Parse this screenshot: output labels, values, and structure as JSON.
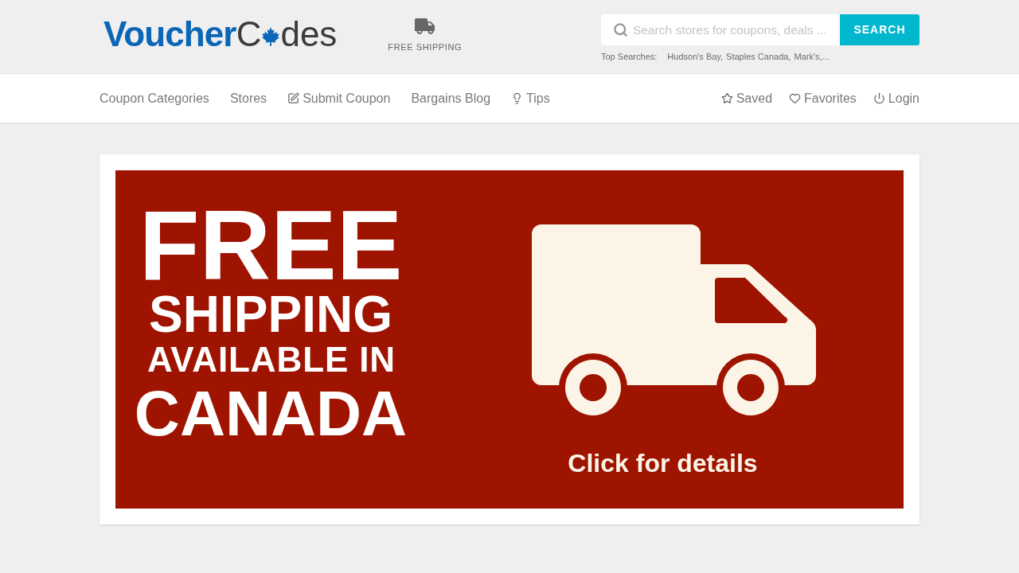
{
  "header": {
    "logo": {
      "first": "Voucher",
      "second_start": "C",
      "second_end": "des"
    },
    "free_shipping_link": "FREE SHIPPING",
    "search": {
      "placeholder": "Search stores for coupons, deals ...",
      "button": "SEARCH"
    },
    "top_searches": {
      "label": "Top Searches:",
      "items": [
        "Hudson's Bay,",
        "Staples Canada,",
        "Mark's,..."
      ]
    }
  },
  "nav": {
    "left": [
      {
        "label": "Coupon Categories",
        "kind": "categories"
      },
      {
        "label": "Stores",
        "kind": "stores"
      },
      {
        "label": "Submit Coupon",
        "kind": "submit"
      },
      {
        "label": "Bargains Blog",
        "kind": "blog"
      },
      {
        "label": "Tips",
        "kind": "tips"
      }
    ],
    "right": [
      {
        "label": "Saved",
        "kind": "saved"
      },
      {
        "label": "Favorites",
        "kind": "favorites"
      },
      {
        "label": "Login",
        "kind": "login"
      }
    ]
  },
  "banner": {
    "headline": [
      {
        "text": "FREE",
        "kind": "huge"
      },
      {
        "text": "SHIPPING",
        "kind": "large"
      },
      {
        "text": "AVAILABLE IN",
        "kind": "medium"
      },
      {
        "text": "CANADA",
        "kind": "wide"
      }
    ],
    "cta": "Click for details"
  }
}
